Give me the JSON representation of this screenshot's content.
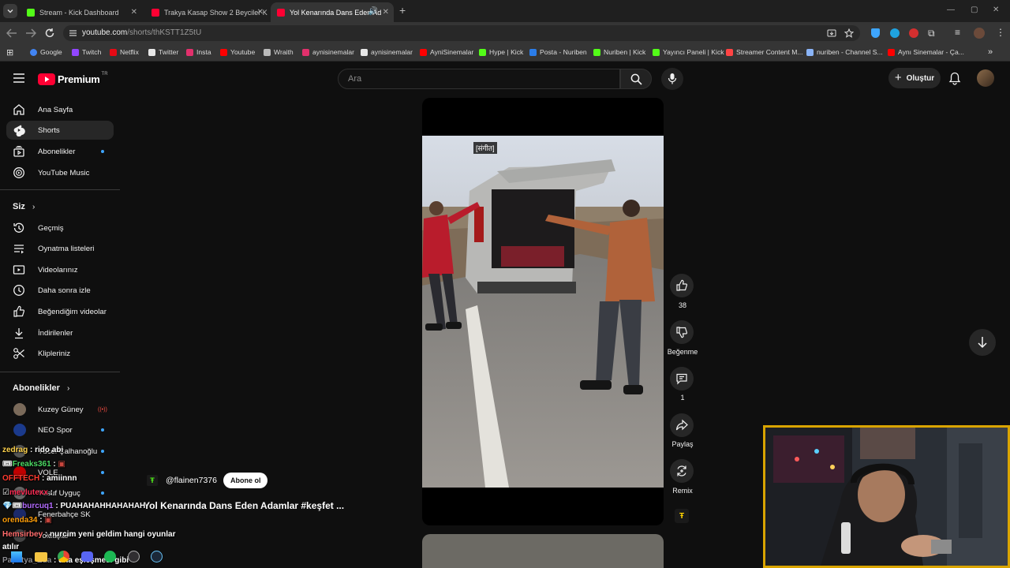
{
  "browser": {
    "tabs": [
      {
        "title": "Stream - Kick Dashboard",
        "active": false,
        "favicon_color": "#53fc18"
      },
      {
        "title": "Trakya Kasap Show 2 Beyciler K",
        "active": false,
        "favicon_color": "#ff0033"
      },
      {
        "title": "Yol Kenarında Dans Eden Ad",
        "active": true,
        "favicon_color": "#ff0033"
      }
    ],
    "url_host": "youtube.com",
    "url_path": "/shorts/thKSTT1Z5tU",
    "bookmarks": [
      {
        "label": "Google",
        "color": "#4285f4"
      },
      {
        "label": "Twitch",
        "color": "#9146ff"
      },
      {
        "label": "Netflix",
        "color": "#e50914"
      },
      {
        "label": "Twitter",
        "color": "#e7e7e7"
      },
      {
        "label": "Insta",
        "color": "#e1306c"
      },
      {
        "label": "Youtube",
        "color": "#ff0000"
      },
      {
        "label": "Wraith",
        "color": "#bbbbbb"
      },
      {
        "label": "aynisinemalar",
        "color": "#e1306c"
      },
      {
        "label": "aynisinemalar",
        "color": "#e7e7e7"
      },
      {
        "label": "AyniSinemalar",
        "color": "#ff0000"
      },
      {
        "label": "Hype | Kick",
        "color": "#53fc18"
      },
      {
        "label": "Posta - Nuriben",
        "color": "#2b7de9"
      },
      {
        "label": "Nuriben | Kick",
        "color": "#53fc18"
      },
      {
        "label": "Yayıncı Paneli | Kick",
        "color": "#53fc18"
      },
      {
        "label": "Streamer Content M...",
        "color": "#ff4444"
      },
      {
        "label": "nuriben - Channel S...",
        "color": "#8ab4f8"
      },
      {
        "label": "Aynı Sinemalar - Ça...",
        "color": "#ff0000"
      }
    ]
  },
  "youtube": {
    "logo_text": "Premium",
    "logo_region": "TR",
    "search_placeholder": "Ara",
    "create_label": "Oluştur",
    "sidebar_main": [
      "Ana Sayfa",
      "Shorts",
      "Abonelikler",
      "YouTube Music"
    ],
    "you_title": "Siz",
    "you_items": [
      "Geçmiş",
      "Oynatma listeleri",
      "Videolarınız",
      "Daha sonra izle",
      "Beğendiğim videolar",
      "İndirilenler",
      "Klipleriniz"
    ],
    "subs_title": "Abonelikler",
    "subscriptions": [
      {
        "name": "Kuzey Güney",
        "color": "#7a6a5a"
      },
      {
        "name": "NEO Spor",
        "color": "#1b3a8c"
      },
      {
        "name": "Yücel Çalhanoğlu",
        "color": "#555555"
      },
      {
        "name": "VOLE",
        "color": "#c00000"
      },
      {
        "name": "Yusuf Uyguç",
        "color": "#666666"
      },
      {
        "name": "Fenerbahçe SK",
        "color": "#1b2a6b"
      },
      {
        "name": "Yoldaşlar",
        "color": "#444444"
      }
    ]
  },
  "short": {
    "overlay_tag": "[संगीत]",
    "channel": "@flainen7376",
    "subscribe_label": "Abone ol",
    "title": "Yol Kenarında Dans Eden Adamlar #keşfet ...",
    "likes": "38",
    "dislike_label": "Beğenme",
    "comments": "1",
    "share_label": "Paylaş",
    "remix_label": "Remix"
  },
  "chat": [
    {
      "user": "zedrag",
      "color": "#ffd34d",
      "msg": "rido abi"
    },
    {
      "user": "Freaks361",
      "color": "#4cd964",
      "msg": ""
    },
    {
      "user": "OFFTECH",
      "color": "#ff3b30",
      "msg": "amiinnn"
    },
    {
      "user": "mevlutexx",
      "color": "#ff2d55",
      "msg": ""
    },
    {
      "user": "burcuq1",
      "color": "#b46cff",
      "msg": "PUAHAHAHHAHAHAH"
    },
    {
      "user": "orenda34",
      "color": "#ff9f0a",
      "msg": ""
    },
    {
      "user": "Hemsirbey",
      "color": "#ff6b6b",
      "msg": "nurcim yeni geldim hangi oyunlar"
    },
    {
      "user": "",
      "color": "#ffffff",
      "msg": "atılır"
    },
    {
      "user": "Papatya_Eda",
      "color": "#8e8e93",
      "msg": "dna eşleşmesi gibi"
    }
  ]
}
